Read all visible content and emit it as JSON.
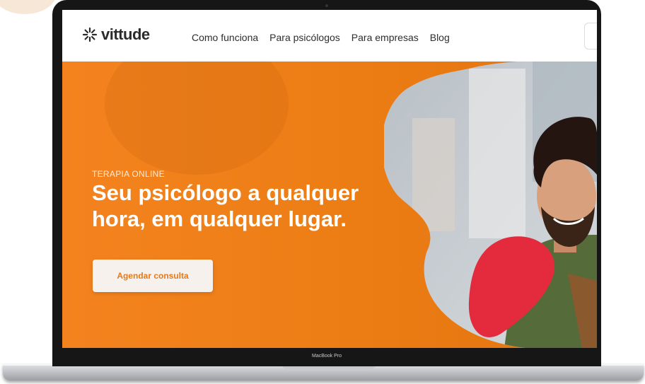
{
  "device": {
    "label": "MacBook Pro"
  },
  "navbar": {
    "brand": "vittude",
    "links": [
      "Como funciona",
      "Para psicólogos",
      "Para empresas",
      "Blog"
    ]
  },
  "hero": {
    "eyebrow": "TERAPIA ONLINE",
    "title_line1": "Seu psicólogo a qualquer",
    "title_line2": "hora, em qualquer lugar.",
    "cta_label": "Agendar consulta"
  },
  "colors": {
    "hero_orange": "#f2801c",
    "accent_red": "#e42b3e",
    "cta_text": "#e47a1a",
    "shirt_green": "#556b3a"
  }
}
